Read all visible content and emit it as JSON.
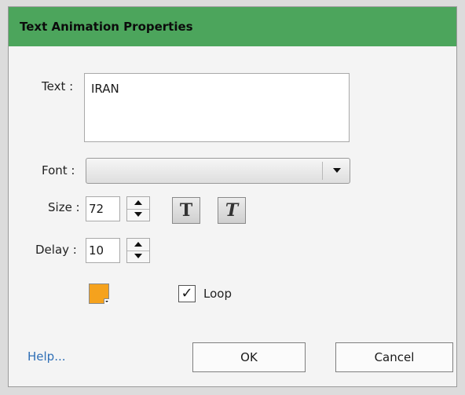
{
  "window": {
    "title": "Text Animation Properties"
  },
  "form": {
    "text_label": "Text :",
    "text_value": "IRAN",
    "font_label": "Font :",
    "font_value": "",
    "size_label": "Size :",
    "size_value": "72",
    "delay_label": "Delay :",
    "delay_value": "10",
    "bold_glyph": "T",
    "italic_glyph": "T",
    "color": "#f5a21d",
    "loop_label": "Loop",
    "loop_checked": true,
    "check_glyph": "✓"
  },
  "footer": {
    "help_label": "Help...",
    "ok_label": "OK",
    "cancel_label": "Cancel"
  },
  "theme": {
    "titlebar": "#4ca55c",
    "link": "#2f6fb6"
  }
}
